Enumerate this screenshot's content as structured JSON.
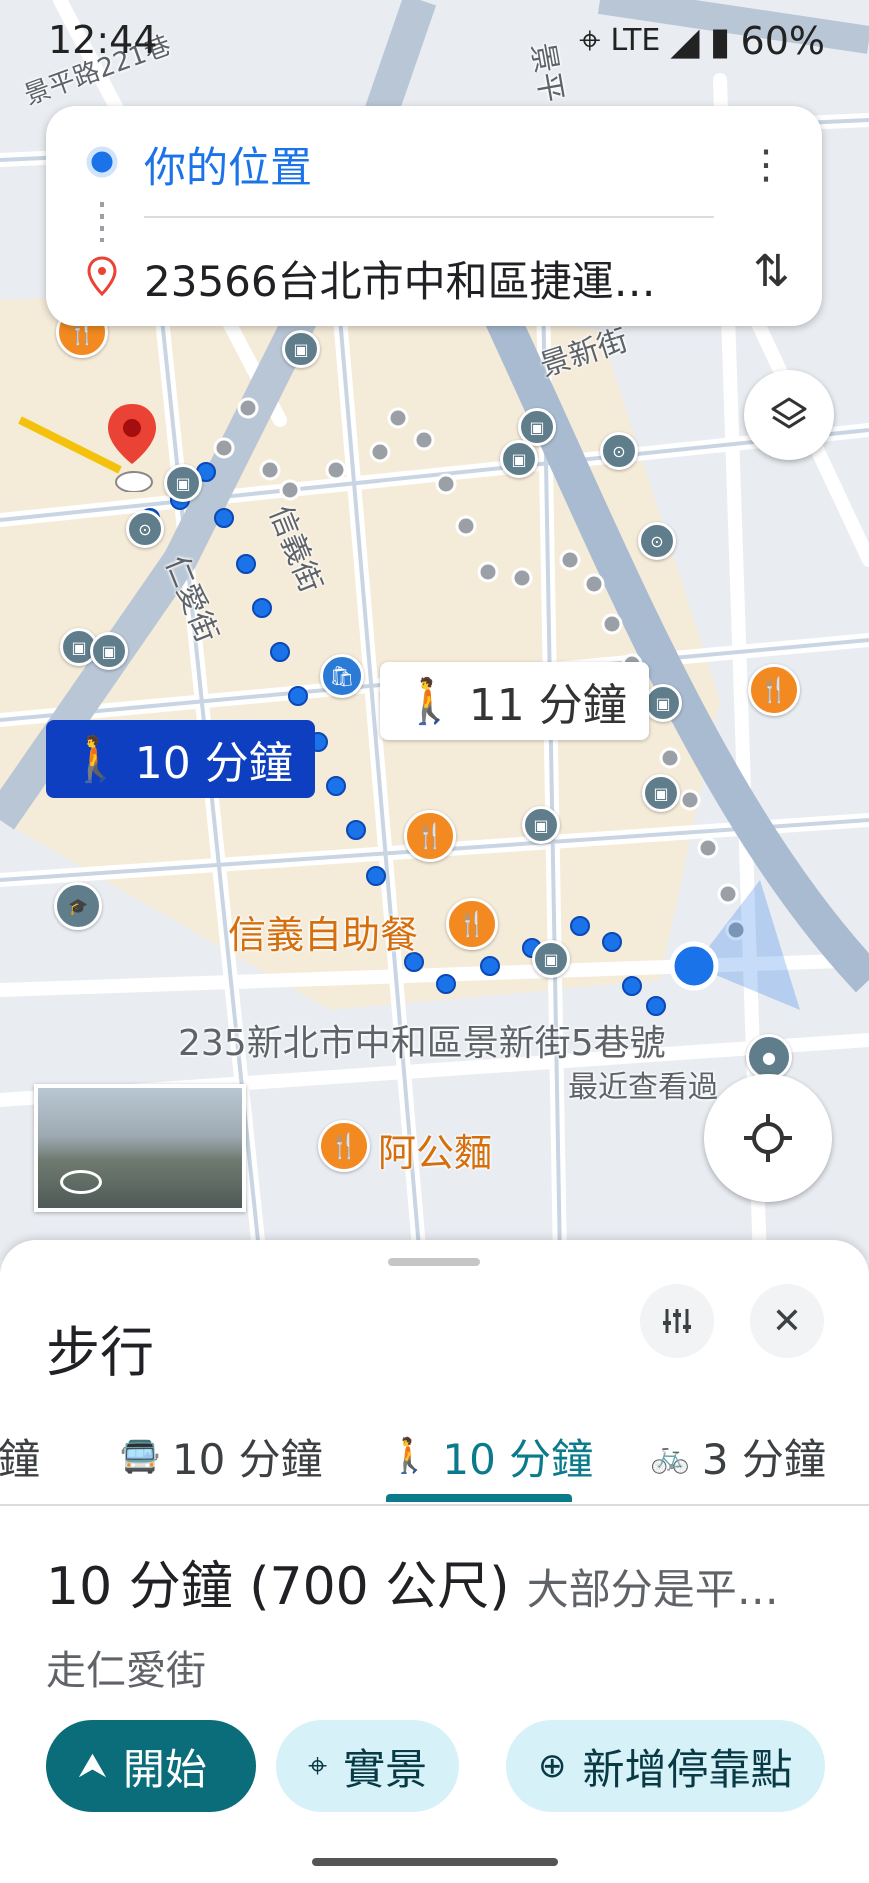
{
  "status_bar": {
    "time": "12:44",
    "network": "LTE",
    "battery": "60%"
  },
  "route_card": {
    "origin": "你的位置",
    "destination": "23566台北市中和區捷運…",
    "more_icon": "more-vert-icon",
    "swap_icon": "swap-vert-icon"
  },
  "map": {
    "streets": {
      "renai": "仁愛街",
      "xinyi": "信義街",
      "jingxin": "景新街",
      "jingping": "景平",
      "jing_top_left": "景平路221巷"
    },
    "route_chips": {
      "primary": "10 分鐘",
      "alternate": "11 分鐘"
    },
    "pois": {
      "restaurant_1": "信義自助餐",
      "restaurant_2": "阿公麵"
    },
    "current_address": "235新北市中和區景新街5巷號",
    "recently_viewed": "最近查看過"
  },
  "sheet": {
    "title": "步行",
    "tabs": [
      {
        "label": "鐘",
        "icon": "car-icon"
      },
      {
        "label": "10 分鐘",
        "icon": "transit-icon"
      },
      {
        "label": "10 分鐘",
        "icon": "walk-icon",
        "active": true
      },
      {
        "label": "3 分鐘",
        "icon": "bike-icon"
      }
    ],
    "summary_main": "10 分鐘 (700 公尺)",
    "summary_sub": "大部分是平…",
    "via": "走仁愛街",
    "actions": {
      "start": "開始",
      "live_view": "實景",
      "add_stop": "新增停靠點"
    }
  },
  "colors": {
    "accent": "#0b7b8b",
    "route_blue": "#1a73e8",
    "chip_primary": "#0d3fc0",
    "poi_orange": "#f28a21"
  }
}
